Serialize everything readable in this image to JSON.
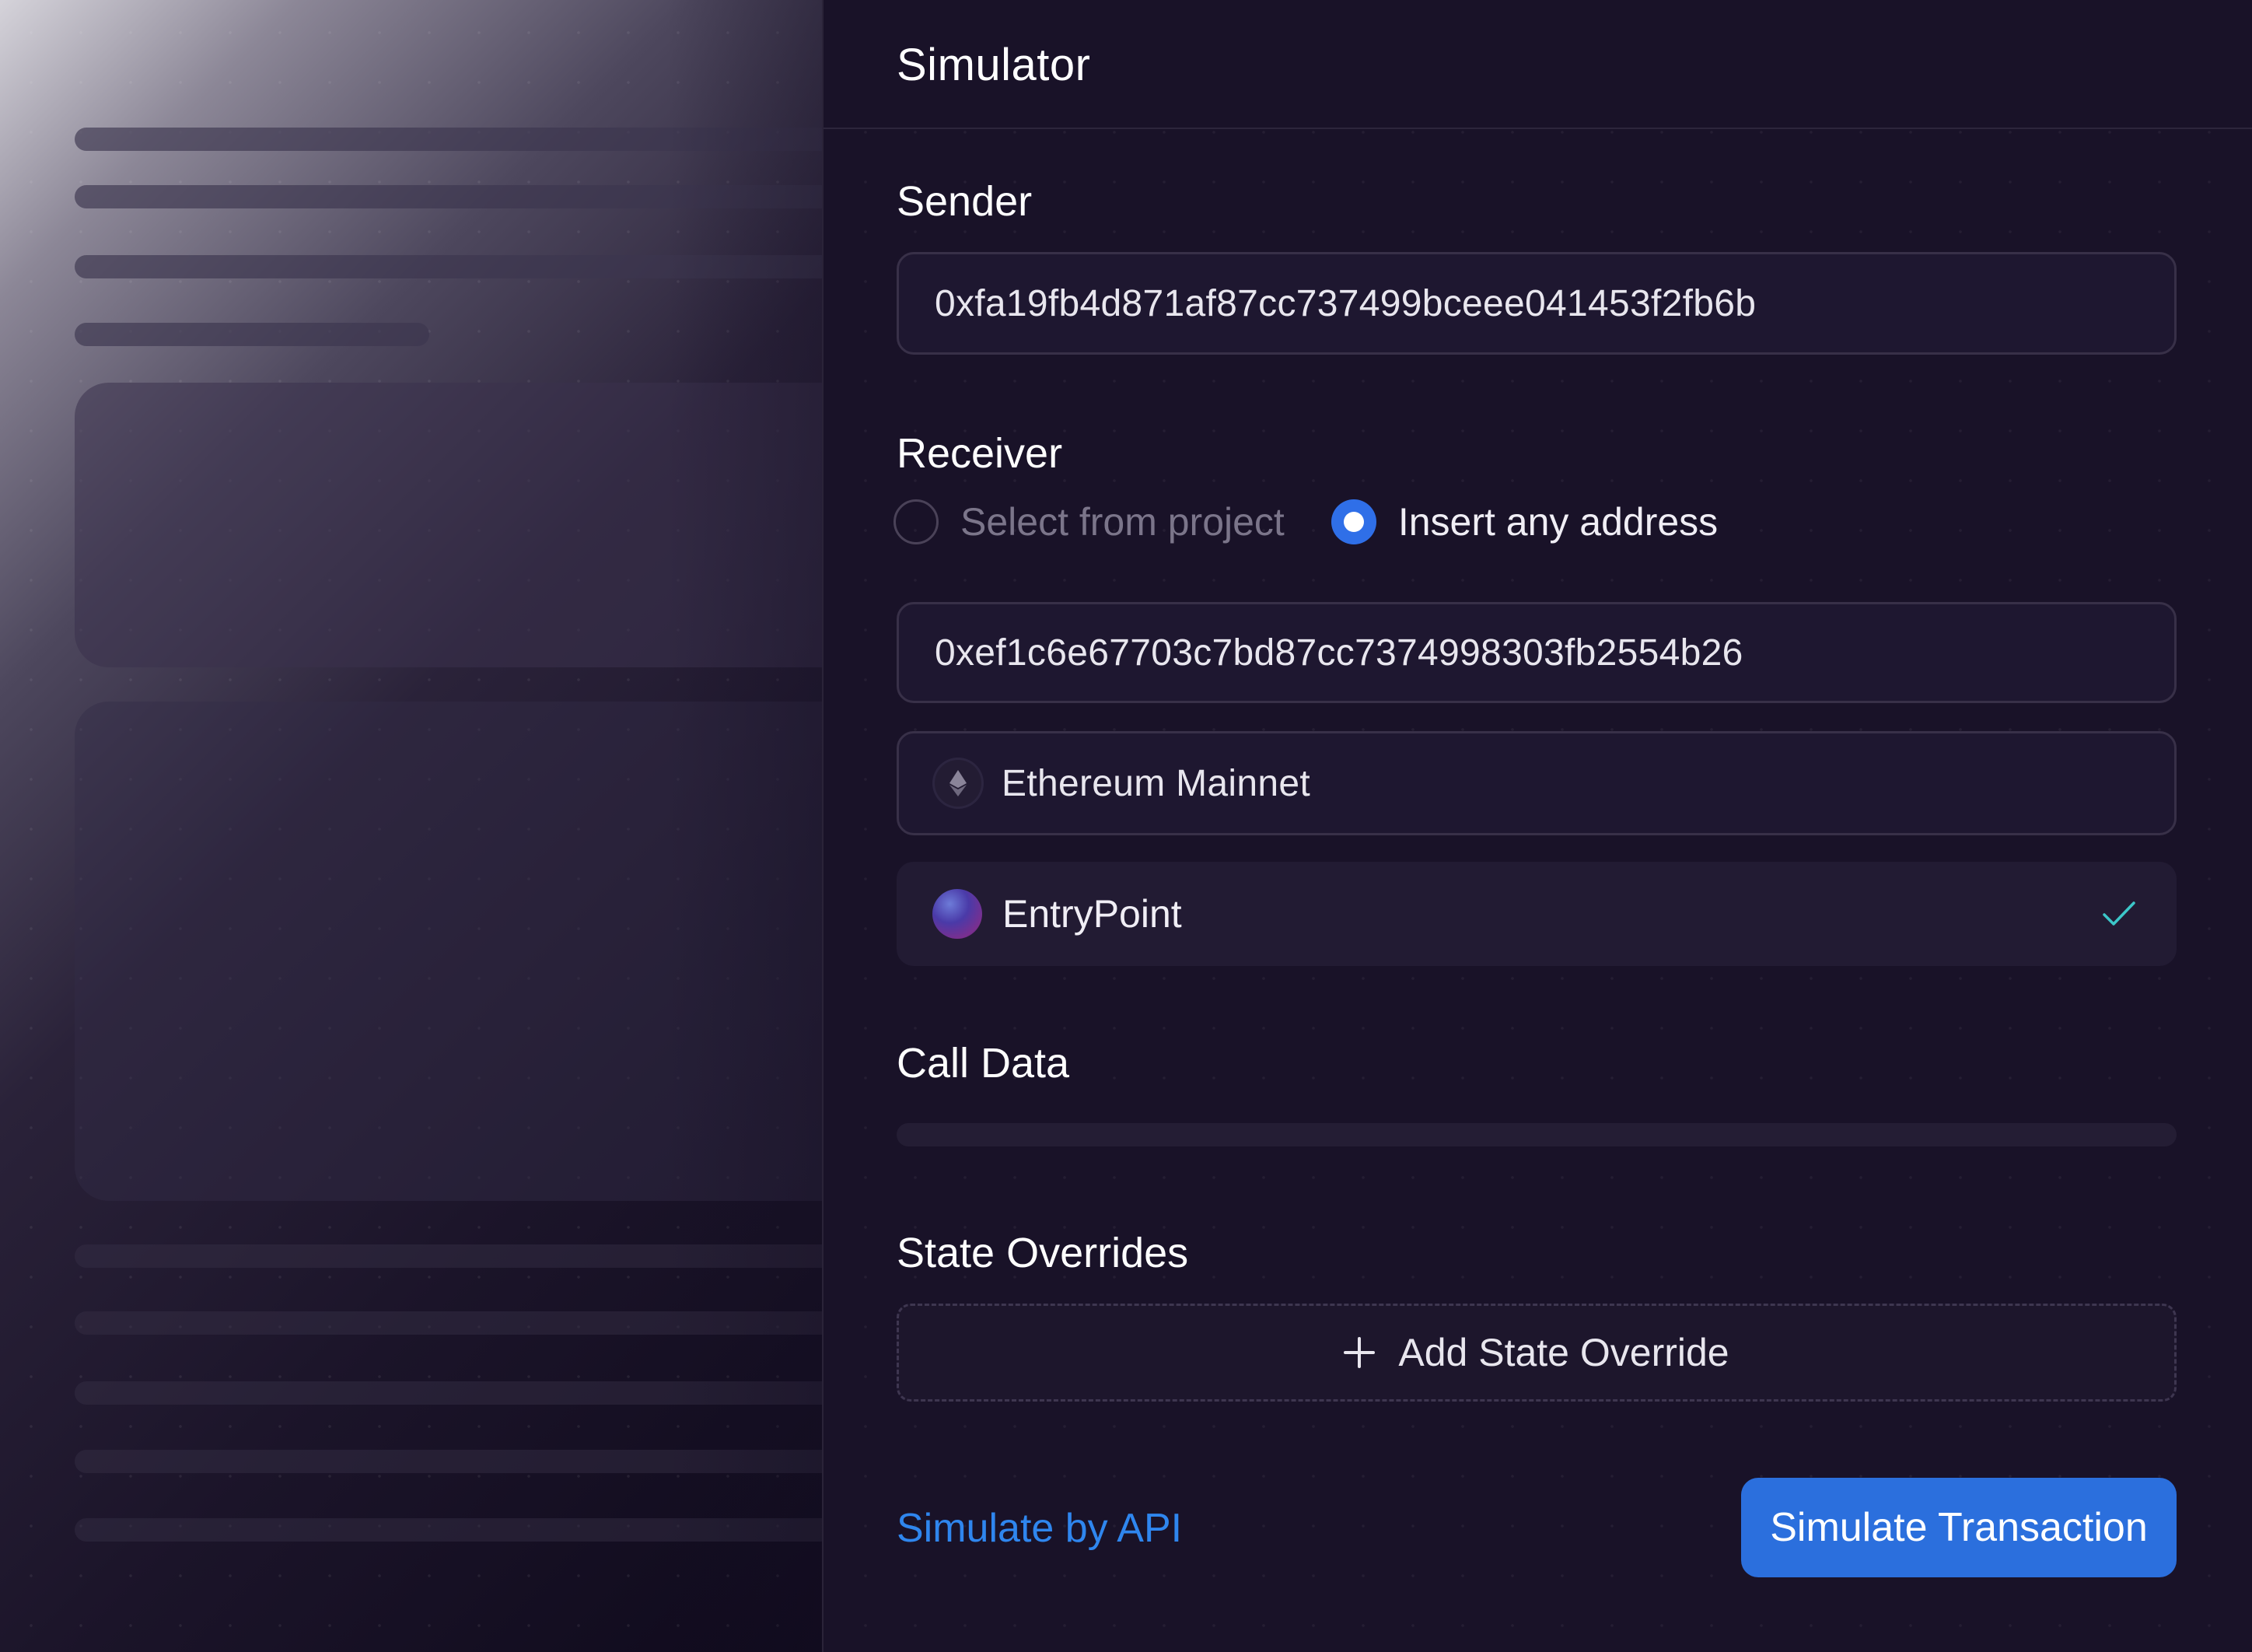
{
  "simulator": {
    "title": "Simulator",
    "sender": {
      "label": "Sender",
      "address": "0xfa19fb4d871af87cc737499bceee041453f2fb6b"
    },
    "receiver": {
      "label": "Receiver",
      "options": [
        {
          "label": "Select from project",
          "selected": false
        },
        {
          "label": "Insert any address",
          "selected": true
        }
      ],
      "address": "0xef1c6e67703c7bd87cc7374998303fb2554b26",
      "network": {
        "name": "Ethereum Mainnet",
        "icon": "ethereum-icon"
      },
      "contract": {
        "name": "EntryPoint",
        "icon": "contract-avatar",
        "verified": true
      }
    },
    "call_data": {
      "label": "Call Data"
    },
    "state_overrides": {
      "label": "State Overrides",
      "add_label": "Add State Override"
    },
    "footer": {
      "api_link": "Simulate by API",
      "submit_label": "Simulate Transaction"
    }
  },
  "colors": {
    "accent": "#2b6fdd",
    "link": "#2f86ee",
    "check": "#3cc7c9",
    "background": "#191228"
  }
}
